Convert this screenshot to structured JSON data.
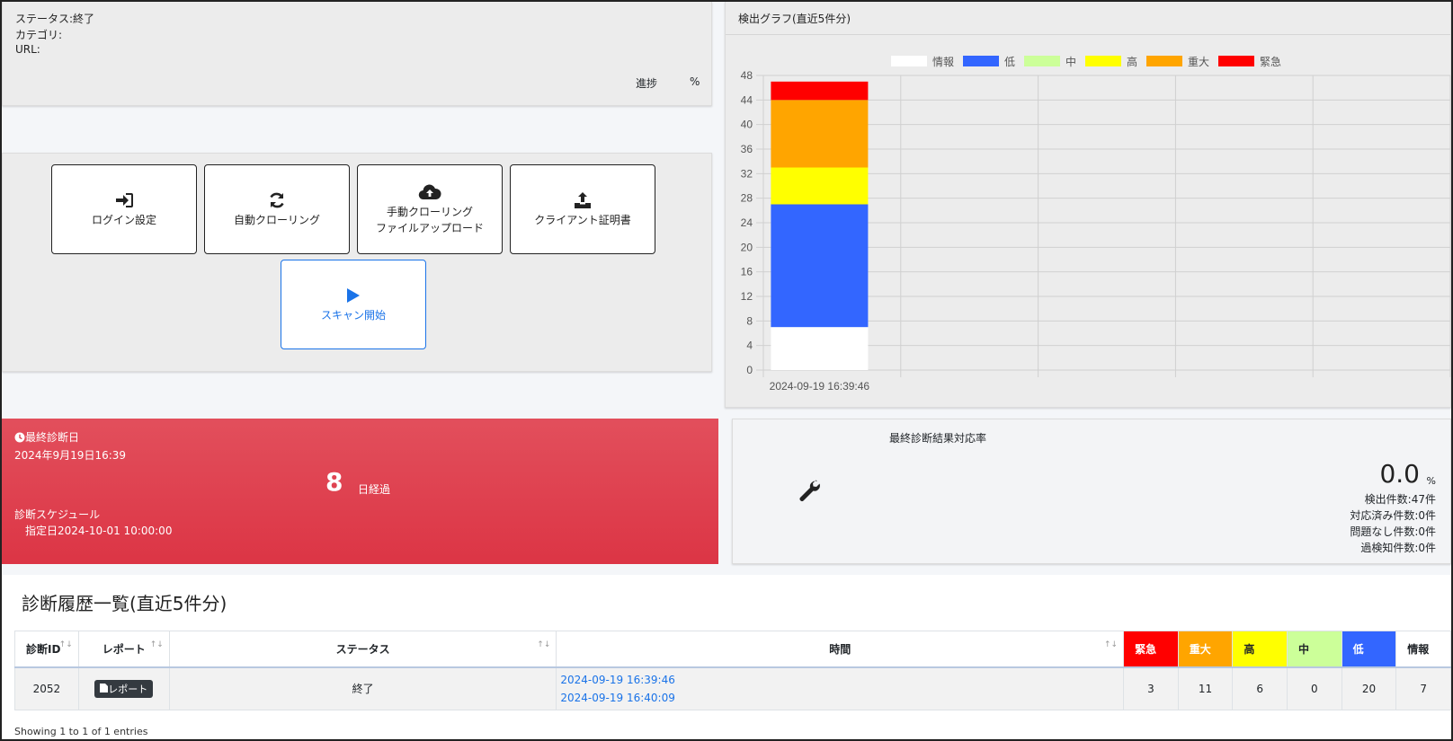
{
  "scan_info": {
    "status": "ステータス:終了",
    "category": "カテゴリ:",
    "url": "URL:",
    "progress_label": "進捗",
    "progress_unit": "%"
  },
  "actions": {
    "login": "ログイン設定",
    "auto_crawl": "自動クローリング",
    "manual_crawl_line1": "手動クローリング",
    "manual_crawl_line2": "ファイルアップロード",
    "client_cert": "クライアント証明書",
    "scan_start": "スキャン開始"
  },
  "chart_panel": {
    "title": "検出グラフ(直近5件分)"
  },
  "chart_data": {
    "type": "bar",
    "stacked": true,
    "categories": [
      "2024-09-19 16:39:46"
    ],
    "ylim": [
      0,
      48
    ],
    "yticks": [
      0,
      4,
      8,
      12,
      16,
      20,
      24,
      28,
      32,
      36,
      40,
      44,
      48
    ],
    "grid": true,
    "legend_position": "top",
    "series": [
      {
        "name": "情報",
        "color": "#ffffff",
        "values": [
          7
        ]
      },
      {
        "name": "低",
        "color": "#3366ff",
        "values": [
          20
        ]
      },
      {
        "name": "中",
        "color": "#ccff99",
        "values": [
          0
        ]
      },
      {
        "name": "高",
        "color": "#ffff00",
        "values": [
          6
        ]
      },
      {
        "name": "重大",
        "color": "#ffa500",
        "values": [
          11
        ]
      },
      {
        "name": "緊急",
        "color": "#ff0000",
        "values": [
          3
        ]
      }
    ]
  },
  "last_scan": {
    "label": "最終診断日",
    "date": "2024年9月19日16:39",
    "days": "8",
    "days_unit": "日経過",
    "schedule_label": "診断スケジュール",
    "schedule_value": "指定日2024-10-01 10:00:00"
  },
  "response_rate": {
    "title": "最終診断結果対応率",
    "value": "0.0",
    "unit": "%",
    "detected": "検出件数:47件",
    "handled": "対応済み件数:0件",
    "no_issue": "問題なし件数:0件",
    "false_positive": "過検知件数:0件"
  },
  "history": {
    "title": "診断履歴一覧(直近5件分)",
    "columns": {
      "id": "診断ID",
      "report": "レポート",
      "status": "ステータス",
      "time": "時間",
      "critical": "緊急",
      "serious": "重大",
      "high": "高",
      "medium": "中",
      "low": "低",
      "info": "情報"
    },
    "column_colors": {
      "critical": "#ff0000",
      "serious": "#ffa500",
      "high": "#ffff00",
      "medium": "#ccff99",
      "low": "#3366ff"
    },
    "rows": [
      {
        "id": "2052",
        "report": "レポート",
        "status": "終了",
        "start": "2024-09-19 16:39:46",
        "end": "2024-09-19 16:40:09",
        "critical": "3",
        "serious": "11",
        "high": "6",
        "medium": "0",
        "low": "20",
        "info": "7"
      }
    ],
    "entries": "Showing 1 to 1 of 1 entries"
  }
}
